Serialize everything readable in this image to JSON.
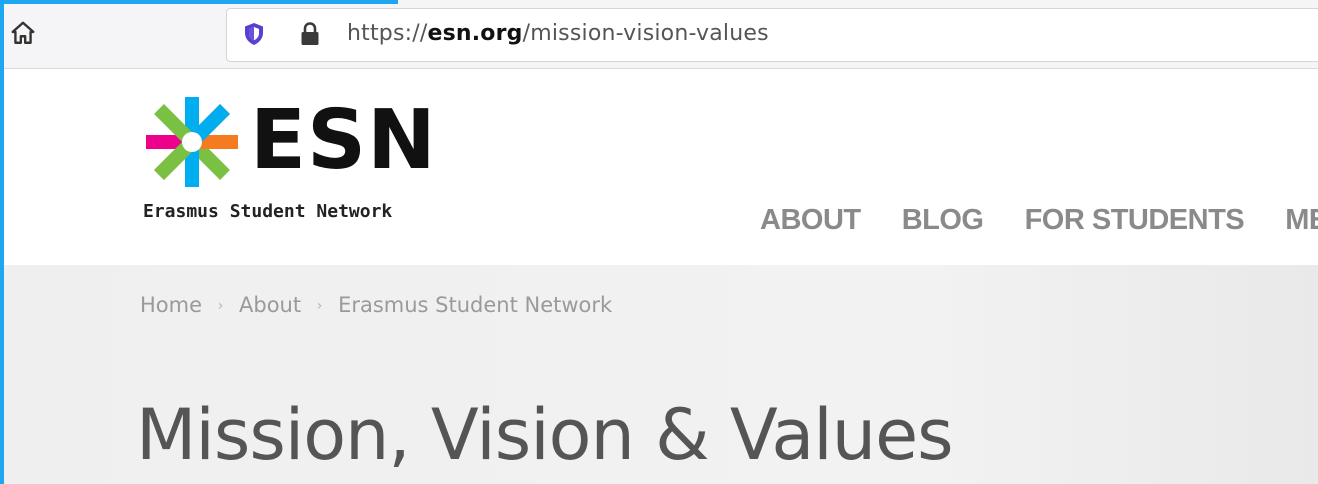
{
  "browser": {
    "url_prefix": "https://",
    "url_domain": "esn.org",
    "url_path": "/mission-vision-values"
  },
  "site": {
    "logo_text": "ESN",
    "logo_tagline": "Erasmus Student Network",
    "logo_colors": [
      "#ec008c",
      "#00aeef",
      "#7ac143",
      "#f47b20",
      "#2e3192"
    ],
    "nav": [
      "ABOUT",
      "BLOG",
      "FOR STUDENTS",
      "MEDIA"
    ]
  },
  "breadcrumb": {
    "items": [
      "Home",
      "About",
      "Erasmus Student Network"
    ],
    "separator": "›"
  },
  "page": {
    "title": "Mission, Vision & Values"
  },
  "icons": {
    "home": "home-icon",
    "shield": "shield-icon",
    "lock": "lock-icon"
  }
}
